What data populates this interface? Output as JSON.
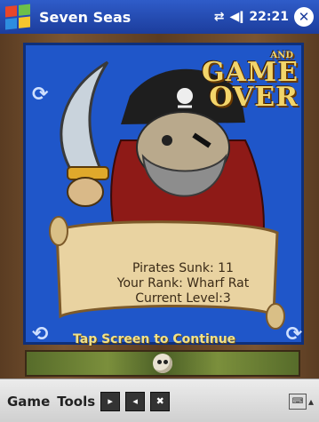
{
  "titlebar": {
    "title": "Seven Seas",
    "time": "22:21",
    "close_label": "✕"
  },
  "game_over": {
    "small_text": "AND",
    "line1": "GAME",
    "line2": "OVER"
  },
  "stats": {
    "pirates_sunk": "Pirates Sunk: 11",
    "rank": "Your Rank: Wharf Rat",
    "level": "Current Level:3"
  },
  "tap_text": "Tap Screen to Continue",
  "menubar": {
    "menu1": "Game",
    "menu2": "Tools",
    "tool1_label": "▸",
    "tool2_label": "◂",
    "tool3_label": "✖",
    "sip_arrow": "▴"
  },
  "colors": {
    "titlebar": "#1c3d9c",
    "panel_bg": "#1f56c9",
    "game_over_text": "#f2d56b"
  }
}
